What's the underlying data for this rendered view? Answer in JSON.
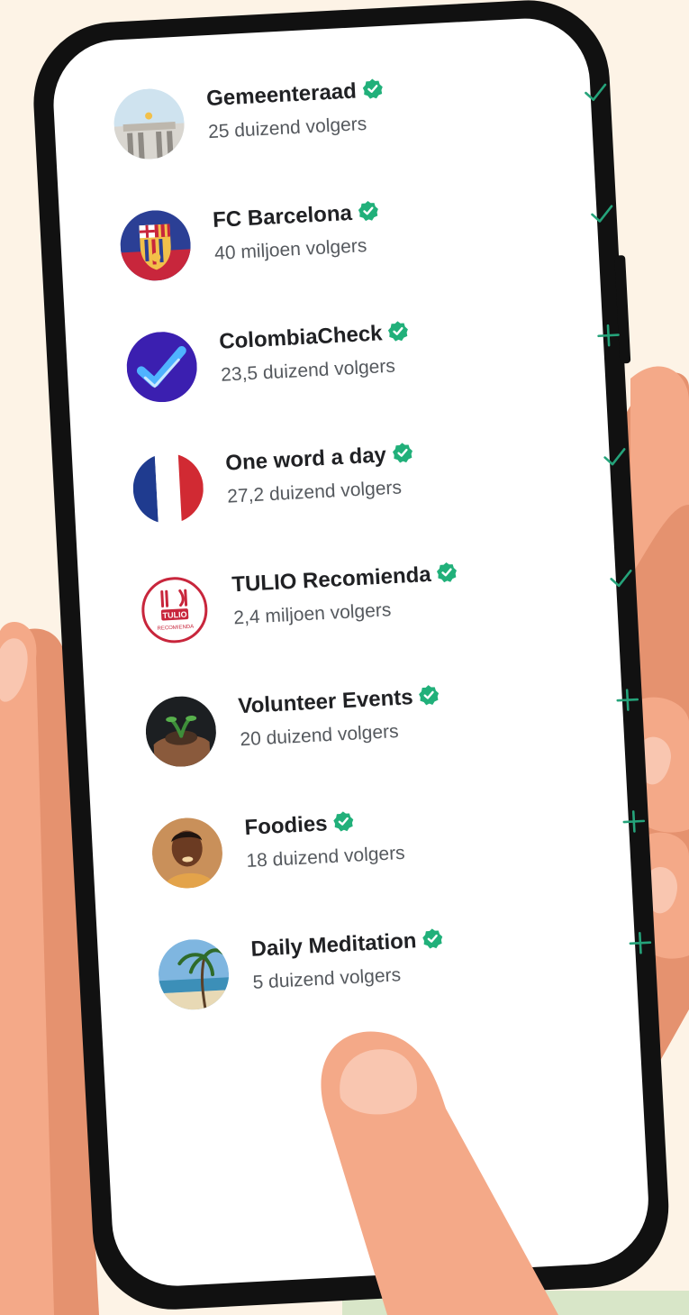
{
  "colors": {
    "background": "#fdf3e6",
    "phone_frame": "#111111",
    "screen": "#ffffff",
    "skin": "#f4a988",
    "skin_shadow": "#e5926f",
    "fingernail": "#f9c6b0",
    "accent_green": "#25a37a",
    "verified_green": "#21b07a",
    "bottom_strip": "#d8e6c8"
  },
  "channels": [
    {
      "name": "Gemeenteraad",
      "followers": "25 duizend volgers",
      "verified": true,
      "action": "check",
      "avatar": "town-hall-avatar"
    },
    {
      "name": "FC Barcelona",
      "followers": "40 miljoen volgers",
      "verified": true,
      "action": "check",
      "avatar": "fc-barcelona-crest-avatar"
    },
    {
      "name": "ColombiaCheck",
      "followers": "23,5 duizend volgers",
      "verified": true,
      "action": "plus",
      "avatar": "colombiacheck-logo-avatar"
    },
    {
      "name": "One word a day",
      "followers": "27,2 duizend volgers",
      "verified": true,
      "action": "check",
      "avatar": "french-flag-avatar"
    },
    {
      "name": "TULIO Recomienda",
      "followers": "2,4 miljoen volgers",
      "verified": true,
      "action": "check",
      "avatar": "tulio-logo-avatar"
    },
    {
      "name": "Volunteer Events",
      "followers": "20 duizend volgers",
      "verified": true,
      "action": "plus",
      "avatar": "hands-with-plant-avatar"
    },
    {
      "name": "Foodies",
      "followers": "18 duizend volgers",
      "verified": true,
      "action": "plus",
      "avatar": "person-eating-avatar"
    },
    {
      "name": "Daily Meditation",
      "followers": "5 duizend volgers",
      "verified": true,
      "action": "plus",
      "avatar": "beach-palm-avatar"
    }
  ],
  "logos": {
    "tulio_badge": "TULIO",
    "tulio_sub": "RECOMIENDA"
  }
}
